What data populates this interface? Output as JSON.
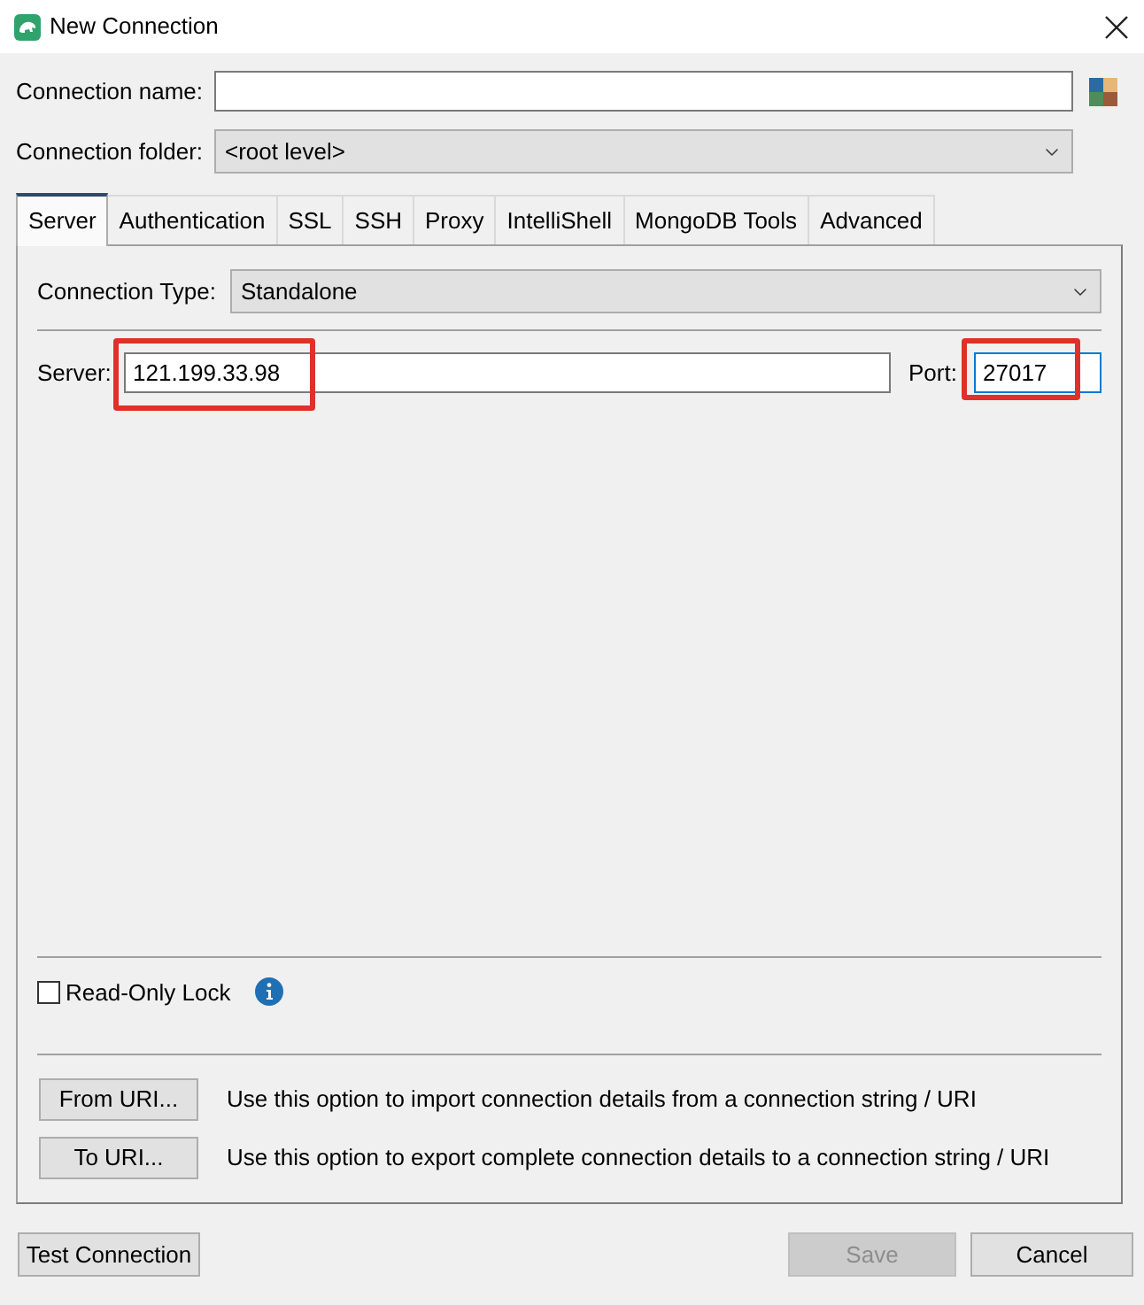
{
  "window": {
    "title": "New Connection"
  },
  "connection_name": {
    "label": "Connection name:"
  },
  "connection_folder": {
    "label": "Connection folder:",
    "value": "<root level>"
  },
  "tabs": [
    {
      "label": "Server",
      "selected": true
    },
    {
      "label": "Authentication",
      "selected": false
    },
    {
      "label": "SSL",
      "selected": false
    },
    {
      "label": "SSH",
      "selected": false
    },
    {
      "label": "Proxy",
      "selected": false
    },
    {
      "label": "IntelliShell",
      "selected": false
    },
    {
      "label": "MongoDB Tools",
      "selected": false
    },
    {
      "label": "Advanced",
      "selected": false
    }
  ],
  "server_tab": {
    "connection_type": {
      "label": "Connection Type:",
      "value": "Standalone"
    },
    "server": {
      "label": "Server:",
      "value": "121.199.33.98",
      "focused": false,
      "highlighted": true
    },
    "port": {
      "label": "Port:",
      "value": "27017",
      "focused": true,
      "highlighted": true
    },
    "read_only_lock": {
      "label": "Read-Only Lock",
      "checked": false
    },
    "uri_actions": [
      {
        "button": "From URI...",
        "description": "Use this option to import connection details from a connection string / URI"
      },
      {
        "button": "To URI...",
        "description": "Use this option to export complete connection details to a connection string / URI"
      }
    ]
  },
  "footer": {
    "left_buttons": [
      {
        "label": "Test Connection",
        "disabled": false
      }
    ],
    "right_buttons": [
      {
        "label": "Save",
        "disabled": true
      },
      {
        "label": "Cancel",
        "disabled": false
      }
    ]
  }
}
